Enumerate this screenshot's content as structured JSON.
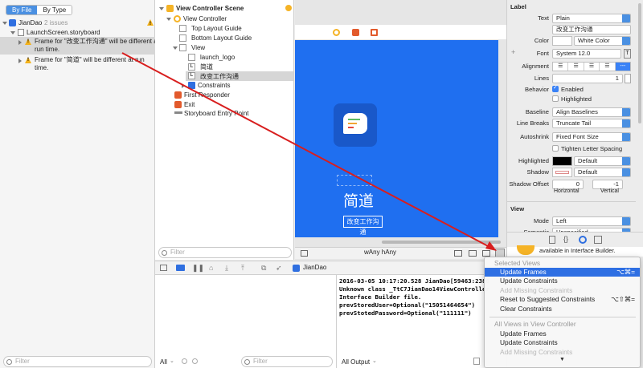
{
  "navigator": {
    "tab_by_file": "By File",
    "tab_by_type": "By Type",
    "project": "JianDao",
    "issue_count": "2 issues",
    "file": "LaunchScreen.storyboard",
    "issues": [
      {
        "line1": "Frame for \"改变工作沟通\" will be different at",
        "line2": "run time."
      },
      {
        "line1": "Frame for \"简道\" will be different at run",
        "line2": "time."
      }
    ],
    "filter_placeholder": "Filter"
  },
  "outline": {
    "scene": "View Controller Scene",
    "items": [
      {
        "label": "View Controller",
        "level": 1
      },
      {
        "label": "Top Layout Guide",
        "level": 2
      },
      {
        "label": "Bottom Layout Guide",
        "level": 2
      },
      {
        "label": "View",
        "level": 2
      },
      {
        "label": "launch_logo",
        "level": 3
      },
      {
        "label": "简道",
        "level": 3
      },
      {
        "label": "改变工作沟通",
        "level": 3
      },
      {
        "label": "Constraints",
        "level": 3
      },
      {
        "label": "First Responder",
        "level": 1
      },
      {
        "label": "Exit",
        "level": 1
      },
      {
        "label": "Storyboard Entry Point",
        "level": 1
      }
    ],
    "filter_placeholder": "Filter"
  },
  "canvas": {
    "title_label": "简道",
    "subtitle_label": "改变工作沟通",
    "size_class": "wAny hAny",
    "colors": {
      "background": "#1f6ff0",
      "logo_bg": "#1958c9"
    }
  },
  "debug": {
    "target": "JianDao",
    "console_lines": [
      "2016-03-05 10:17:20.528 JianDao[59463:2386",
      "Unknown class _TtC7JianDao14ViewController",
      "Interface Builder file.",
      "prevStoredUser=Optional(\"15051464654\")",
      "prevStotedPassword=Optional(\"111111\")"
    ],
    "vars_scope": "All",
    "output_scope": "All Output",
    "filter_placeholder": "Filter"
  },
  "inspector": {
    "label_section": "Label",
    "text_label": "Text",
    "text_value": "Plain",
    "text_content": "改变工作沟通",
    "color_label": "Color",
    "color_value": "White Color",
    "font_label": "Font",
    "font_value": "System 12.0",
    "alignment_label": "Alignment",
    "lines_label": "Lines",
    "lines_value": "1",
    "behavior_label": "Behavior",
    "enabled_label": "Enabled",
    "highlighted_label": "Highlighted",
    "baseline_label": "Baseline",
    "baseline_value": "Align Baselines",
    "linebreaks_label": "Line Breaks",
    "linebreaks_value": "Truncate Tail",
    "autoshrink_label": "Autoshrink",
    "autoshrink_value": "Fixed Font Size",
    "tighten_label": "Tighten Letter Spacing",
    "highlighted_color_label": "Highlighted",
    "highlighted_color_value": "Default",
    "shadow_label": "Shadow",
    "shadow_value": "Default",
    "shadow_offset_label": "Shadow Offset",
    "shadow_offset_h": "0",
    "shadow_offset_v": "-1",
    "horizontal_label": "Horizontal",
    "vertical_label": "Vertical",
    "view_section": "View",
    "mode_label": "Mode",
    "mode_value": "Left",
    "semantic_label": "Semantic",
    "semantic_value": "Unspecified",
    "ib_note": "available in Interface Builder."
  },
  "menu": {
    "section1": "Selected Views",
    "items1": [
      {
        "label": "Update Frames",
        "shortcut": "⌥⌘=",
        "state": "highlighted"
      },
      {
        "label": "Update Constraints",
        "shortcut": "",
        "state": "enabled"
      },
      {
        "label": "Add Missing Constraints",
        "shortcut": "",
        "state": "disabled"
      },
      {
        "label": "Reset to Suggested Constraints",
        "shortcut": "⌥⇧⌘=",
        "state": "enabled"
      },
      {
        "label": "Clear Constraints",
        "shortcut": "",
        "state": "enabled"
      }
    ],
    "section2": "All Views in View Controller",
    "items2": [
      {
        "label": "Update Frames",
        "shortcut": "",
        "state": "enabled"
      },
      {
        "label": "Update Constraints",
        "shortcut": "",
        "state": "enabled"
      },
      {
        "label": "Add Missing Constraints",
        "shortcut": "",
        "state": "disabled"
      }
    ],
    "more_indicator": "▼"
  },
  "annotation": {
    "arrow_color": "#d81e1e"
  }
}
